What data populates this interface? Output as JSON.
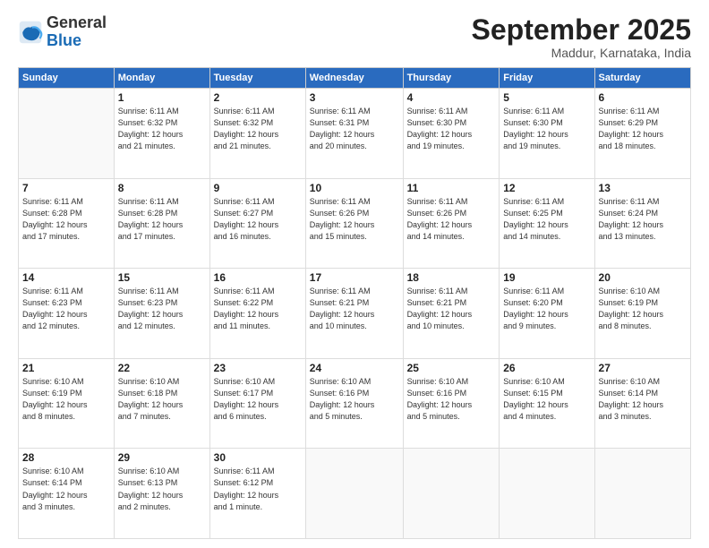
{
  "logo": {
    "general": "General",
    "blue": "Blue"
  },
  "header": {
    "month": "September 2025",
    "location": "Maddur, Karnataka, India"
  },
  "weekdays": [
    "Sunday",
    "Monday",
    "Tuesday",
    "Wednesday",
    "Thursday",
    "Friday",
    "Saturday"
  ],
  "weeks": [
    [
      {
        "day": "",
        "info": ""
      },
      {
        "day": "1",
        "info": "Sunrise: 6:11 AM\nSunset: 6:32 PM\nDaylight: 12 hours\nand 21 minutes."
      },
      {
        "day": "2",
        "info": "Sunrise: 6:11 AM\nSunset: 6:32 PM\nDaylight: 12 hours\nand 21 minutes."
      },
      {
        "day": "3",
        "info": "Sunrise: 6:11 AM\nSunset: 6:31 PM\nDaylight: 12 hours\nand 20 minutes."
      },
      {
        "day": "4",
        "info": "Sunrise: 6:11 AM\nSunset: 6:30 PM\nDaylight: 12 hours\nand 19 minutes."
      },
      {
        "day": "5",
        "info": "Sunrise: 6:11 AM\nSunset: 6:30 PM\nDaylight: 12 hours\nand 19 minutes."
      },
      {
        "day": "6",
        "info": "Sunrise: 6:11 AM\nSunset: 6:29 PM\nDaylight: 12 hours\nand 18 minutes."
      }
    ],
    [
      {
        "day": "7",
        "info": "Sunrise: 6:11 AM\nSunset: 6:28 PM\nDaylight: 12 hours\nand 17 minutes."
      },
      {
        "day": "8",
        "info": "Sunrise: 6:11 AM\nSunset: 6:28 PM\nDaylight: 12 hours\nand 17 minutes."
      },
      {
        "day": "9",
        "info": "Sunrise: 6:11 AM\nSunset: 6:27 PM\nDaylight: 12 hours\nand 16 minutes."
      },
      {
        "day": "10",
        "info": "Sunrise: 6:11 AM\nSunset: 6:26 PM\nDaylight: 12 hours\nand 15 minutes."
      },
      {
        "day": "11",
        "info": "Sunrise: 6:11 AM\nSunset: 6:26 PM\nDaylight: 12 hours\nand 14 minutes."
      },
      {
        "day": "12",
        "info": "Sunrise: 6:11 AM\nSunset: 6:25 PM\nDaylight: 12 hours\nand 14 minutes."
      },
      {
        "day": "13",
        "info": "Sunrise: 6:11 AM\nSunset: 6:24 PM\nDaylight: 12 hours\nand 13 minutes."
      }
    ],
    [
      {
        "day": "14",
        "info": "Sunrise: 6:11 AM\nSunset: 6:23 PM\nDaylight: 12 hours\nand 12 minutes."
      },
      {
        "day": "15",
        "info": "Sunrise: 6:11 AM\nSunset: 6:23 PM\nDaylight: 12 hours\nand 12 minutes."
      },
      {
        "day": "16",
        "info": "Sunrise: 6:11 AM\nSunset: 6:22 PM\nDaylight: 12 hours\nand 11 minutes."
      },
      {
        "day": "17",
        "info": "Sunrise: 6:11 AM\nSunset: 6:21 PM\nDaylight: 12 hours\nand 10 minutes."
      },
      {
        "day": "18",
        "info": "Sunrise: 6:11 AM\nSunset: 6:21 PM\nDaylight: 12 hours\nand 10 minutes."
      },
      {
        "day": "19",
        "info": "Sunrise: 6:11 AM\nSunset: 6:20 PM\nDaylight: 12 hours\nand 9 minutes."
      },
      {
        "day": "20",
        "info": "Sunrise: 6:10 AM\nSunset: 6:19 PM\nDaylight: 12 hours\nand 8 minutes."
      }
    ],
    [
      {
        "day": "21",
        "info": "Sunrise: 6:10 AM\nSunset: 6:19 PM\nDaylight: 12 hours\nand 8 minutes."
      },
      {
        "day": "22",
        "info": "Sunrise: 6:10 AM\nSunset: 6:18 PM\nDaylight: 12 hours\nand 7 minutes."
      },
      {
        "day": "23",
        "info": "Sunrise: 6:10 AM\nSunset: 6:17 PM\nDaylight: 12 hours\nand 6 minutes."
      },
      {
        "day": "24",
        "info": "Sunrise: 6:10 AM\nSunset: 6:16 PM\nDaylight: 12 hours\nand 5 minutes."
      },
      {
        "day": "25",
        "info": "Sunrise: 6:10 AM\nSunset: 6:16 PM\nDaylight: 12 hours\nand 5 minutes."
      },
      {
        "day": "26",
        "info": "Sunrise: 6:10 AM\nSunset: 6:15 PM\nDaylight: 12 hours\nand 4 minutes."
      },
      {
        "day": "27",
        "info": "Sunrise: 6:10 AM\nSunset: 6:14 PM\nDaylight: 12 hours\nand 3 minutes."
      }
    ],
    [
      {
        "day": "28",
        "info": "Sunrise: 6:10 AM\nSunset: 6:14 PM\nDaylight: 12 hours\nand 3 minutes."
      },
      {
        "day": "29",
        "info": "Sunrise: 6:10 AM\nSunset: 6:13 PM\nDaylight: 12 hours\nand 2 minutes."
      },
      {
        "day": "30",
        "info": "Sunrise: 6:11 AM\nSunset: 6:12 PM\nDaylight: 12 hours\nand 1 minute."
      },
      {
        "day": "",
        "info": ""
      },
      {
        "day": "",
        "info": ""
      },
      {
        "day": "",
        "info": ""
      },
      {
        "day": "",
        "info": ""
      }
    ]
  ]
}
